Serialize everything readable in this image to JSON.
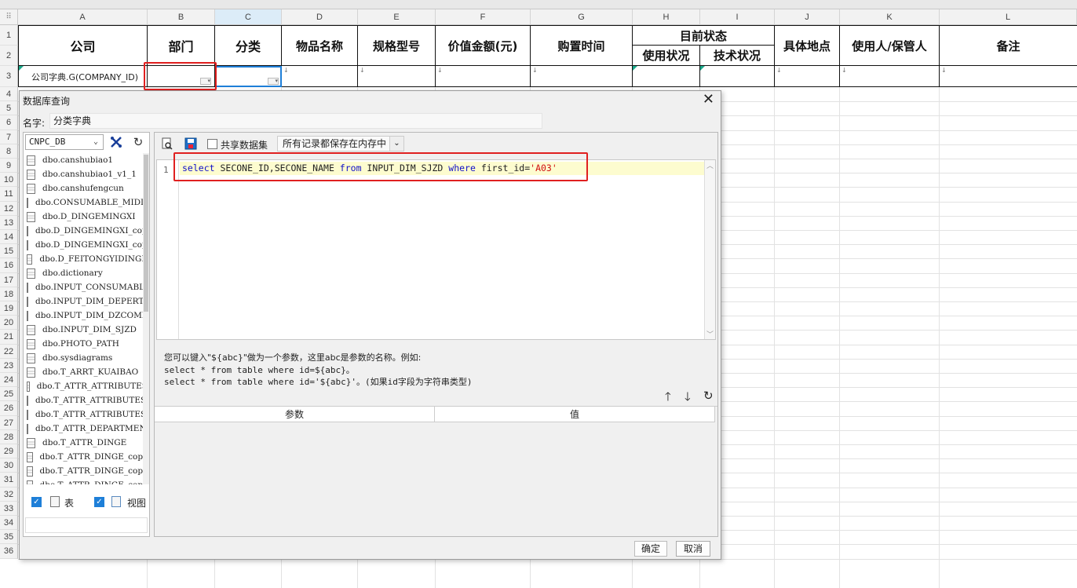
{
  "sheet": {
    "corner_label": "⠿",
    "columns": [
      "A",
      "B",
      "C",
      "D",
      "E",
      "F",
      "G",
      "H",
      "I",
      "J",
      "K",
      "L"
    ],
    "selected_column": "C",
    "rows": [
      "1",
      "2",
      "3",
      "4",
      "5",
      "6",
      "7",
      "8",
      "9",
      "10",
      "11",
      "12",
      "13",
      "14",
      "15",
      "16",
      "17",
      "18",
      "19",
      "20",
      "21",
      "22",
      "23",
      "24",
      "25",
      "26",
      "27",
      "28",
      "29",
      "30",
      "31",
      "32",
      "33",
      "34",
      "35",
      "36"
    ],
    "headers": {
      "company": "公司",
      "department": "部门",
      "category": "分类",
      "item_name": "物品名称",
      "spec": "规格型号",
      "value": "价值金额(元)",
      "purchase_time": "购置时间",
      "current_status": "目前状态",
      "usage_status": "使用状况",
      "tech_status": "技术状况",
      "location": "具体地点",
      "user_keeper": "使用人/保管人",
      "remark": "备注"
    },
    "row3_a_value": "公司字典.G(COMPANY_ID)"
  },
  "dialog": {
    "title": "数据库查询",
    "name_label": "名字:",
    "name_value": "分类字典",
    "db_select": "CNPC_DB",
    "share_dataset_label": "共享数据集",
    "memory_option": "所有记录都保存在内存中",
    "tables": [
      "dbo.canshubiao1",
      "dbo.canshubiao1_v1_1",
      "dbo.canshufengcun",
      "dbo.CONSUMABLE_MIDDLE_",
      "dbo.D_DINGEMINGXI",
      "dbo.D_DINGEMINGXI_copy",
      "dbo.D_DINGEMINGXI_copy",
      "dbo.D_FEITONGYIDINGE",
      "dbo.dictionary",
      "dbo.INPUT_CONSUMABLE",
      "dbo.INPUT_DIM_DEPERTME",
      "dbo.INPUT_DIM_DZCOMPAN",
      "dbo.INPUT_DIM_SJZD",
      "dbo.PHOTO_PATH",
      "dbo.sysdiagrams",
      "dbo.T_ARRT_KUAIBAO",
      "dbo.T_ATTR_ATTRIBUTES",
      "dbo.T_ATTR_ATTRIBUTES_",
      "dbo.T_ATTR_ATTRIBUTES_",
      "dbo.T_ATTR_DEPARTMENT",
      "dbo.T_ATTR_DINGE",
      "dbo.T_ATTR_DINGE_copy",
      "dbo.T_ATTR_DINGE_copy",
      "dbo.T_ATTR_DINGE_copy"
    ],
    "filter_table_label": "表",
    "filter_view_label": "视图",
    "sql_line_number": "1",
    "sql": {
      "select": "select",
      "fields": " SECONE_ID,SECONE_NAME ",
      "from": "from",
      "table": " INPUT_DIM_SJZD ",
      "where": "where",
      "condition": " first_id=",
      "literal": "'A03'"
    },
    "hint_line1": "您可以键入\"${abc}\"做为一个参数，这里abc是参数的名称。例如:",
    "hint_line2": "select * from table where id=${abc}。",
    "hint_line3": "select * from table where id='${abc}'。(如果id字段为字符串类型)",
    "param_col": "参数",
    "value_col": "值",
    "ok_button": "确定",
    "cancel_button": "取消"
  },
  "colors": {
    "highlight_red": "#e02020",
    "selection_blue": "#1e7fd8",
    "sql_keyword": "#1010c8",
    "sql_string": "#d01010",
    "current_line_bg": "#fdfccf"
  }
}
